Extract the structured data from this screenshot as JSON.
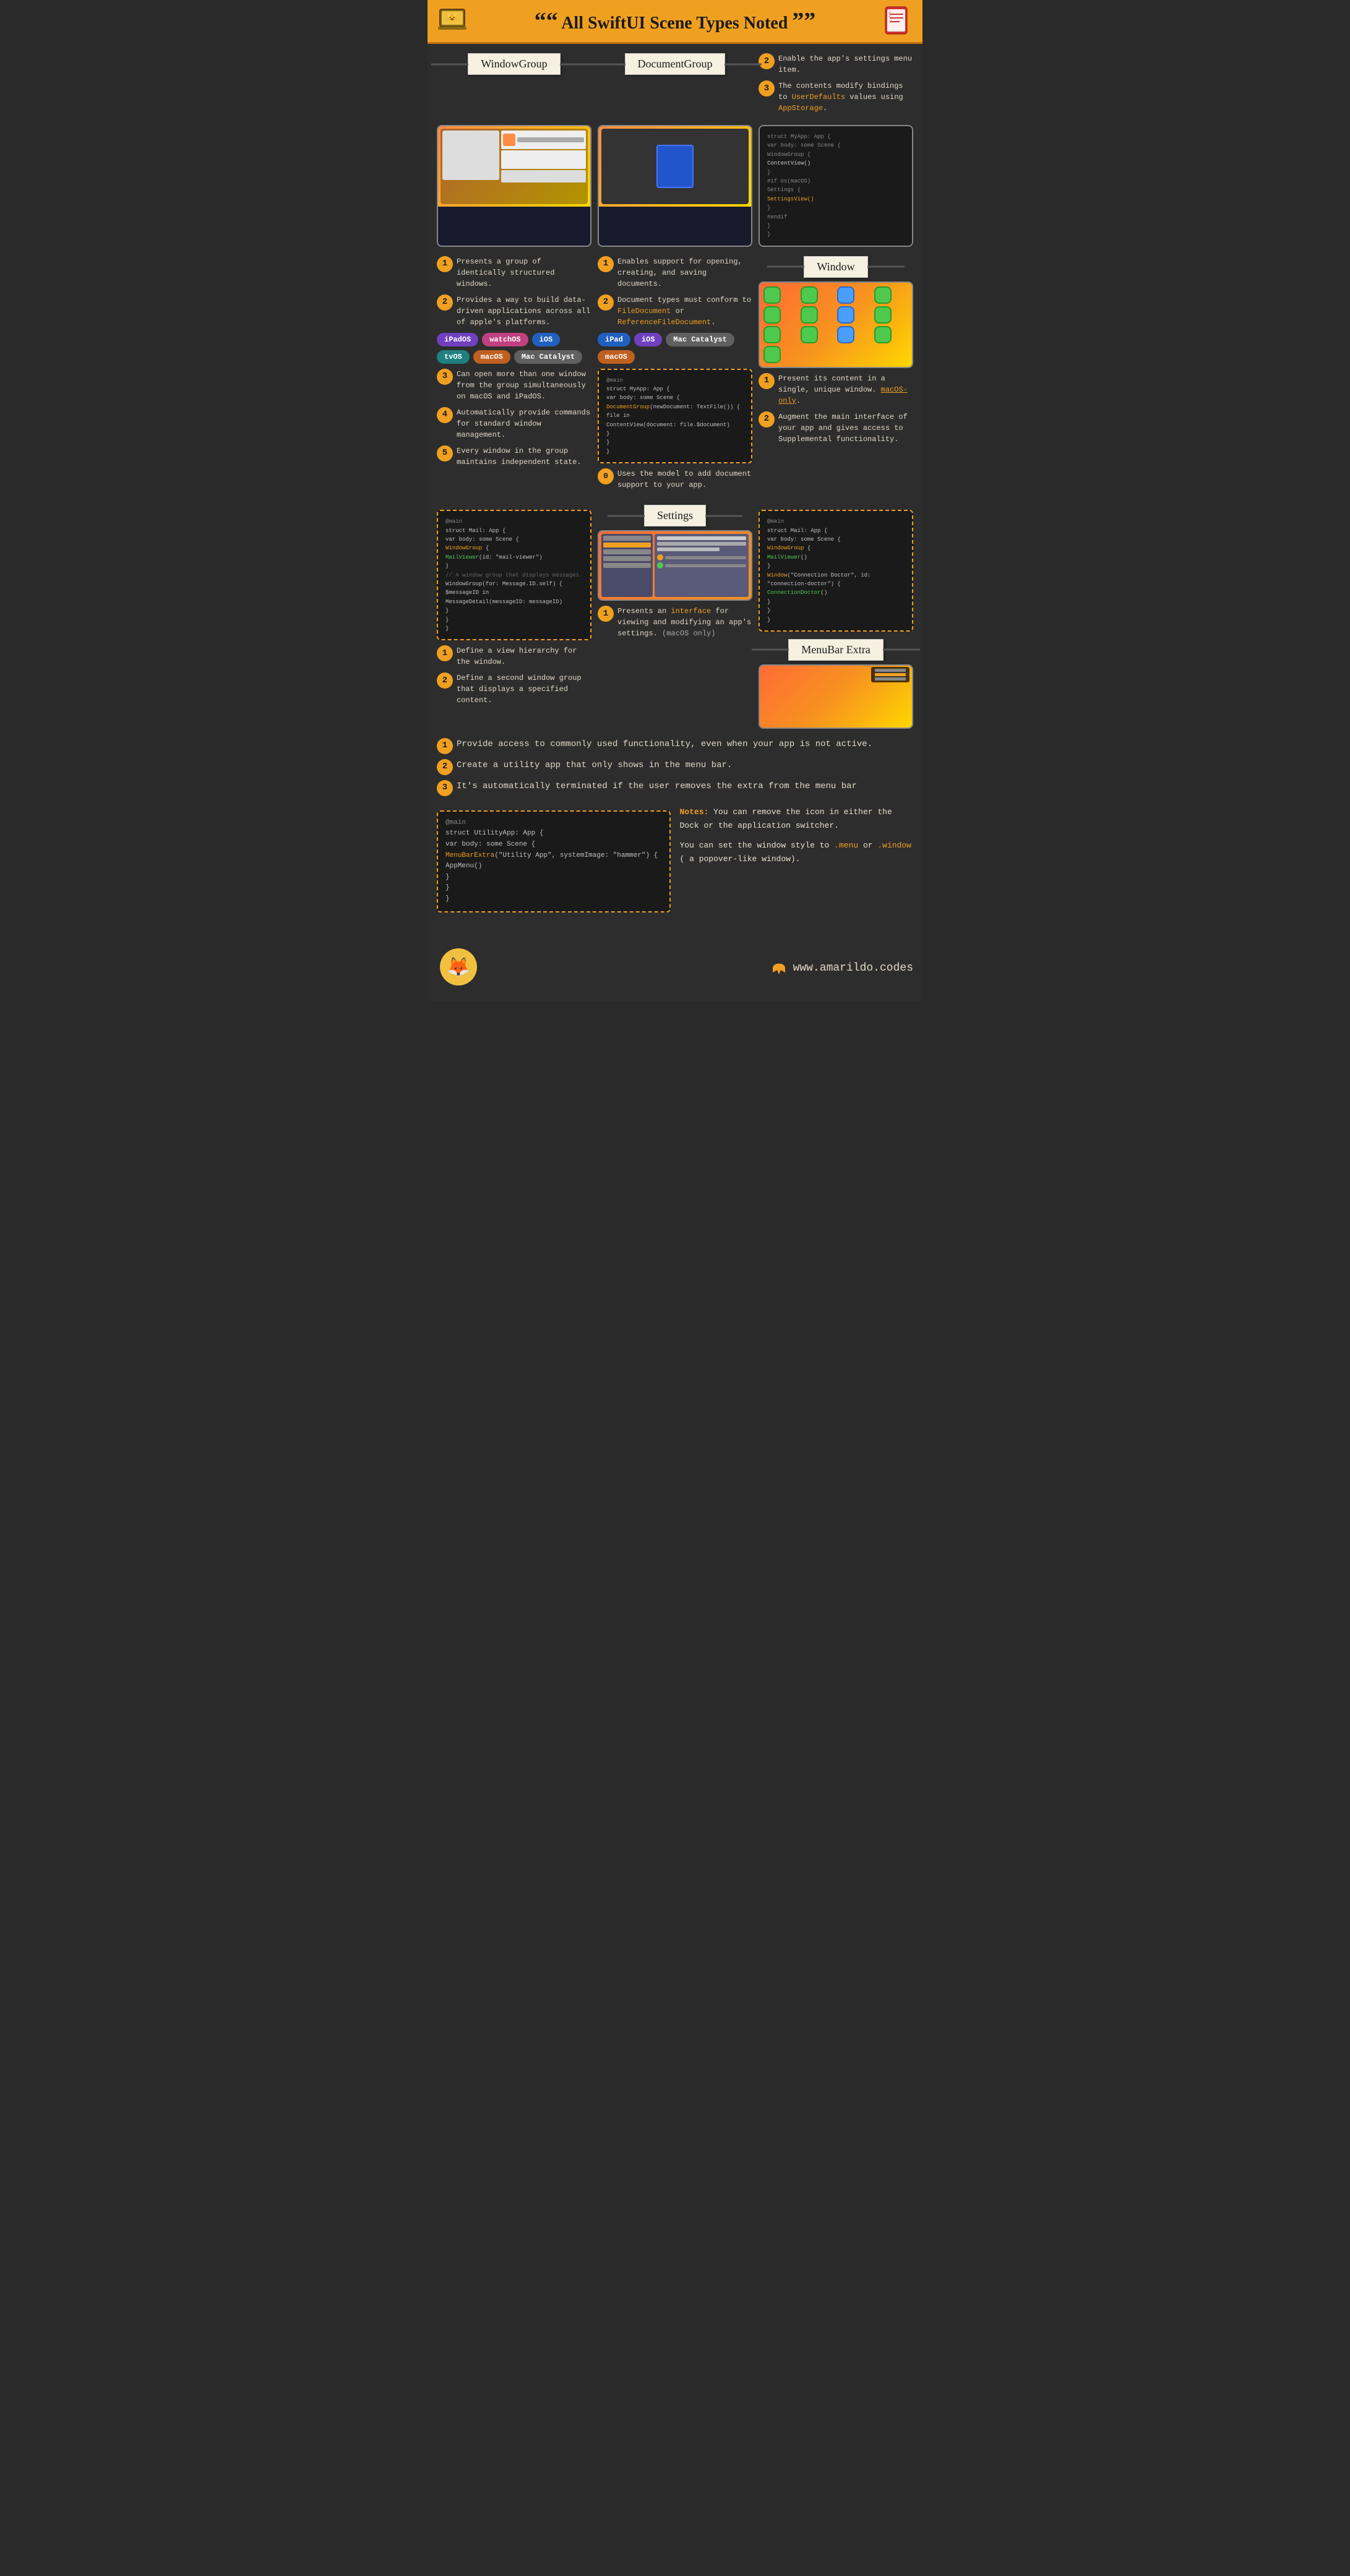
{
  "header": {
    "title": "All SwiftUI Scene Types Noted",
    "quote_open": "““",
    "quote_close": "””"
  },
  "sections": {
    "windowGroup": {
      "label": "WindowGroup",
      "point1": "Presents a group of identically structured windows.",
      "point2": "Provides a way to build data-driven applications across all of apple's platforms.",
      "point3": "Can open more than one window from the group simultaneously on macOS and iPadOS.",
      "point4": "Automatically provide commands for standard window management.",
      "point5": "Every window in the group maintains independent state.",
      "platforms": [
        "iPadOS",
        "watchOS",
        "iOS",
        "tvOS",
        "macOS",
        "Mac Catalyst"
      ],
      "point_define1": "Define a view hierarchy for the window.",
      "point_define2": "Define a second window group that displays a specified content."
    },
    "documentGroup": {
      "label": "DocumentGroup",
      "point1": "Enables support for opening, creating, and saving documents.",
      "point2": "Document types must conform to FileDocument or ReferenceFileDocument.",
      "platforms": [
        "iPad",
        "iOS",
        "Mac Catalyst",
        "macOS"
      ],
      "point_model": "Uses the model to add document support to your app."
    },
    "settings": {
      "label": "Settings",
      "point1": "Presents an interface for viewing and modifying an app's settings. (macOS only)"
    },
    "settingsRight": {
      "point2": "Enable the app's settings menu item.",
      "point3": "The contents modify bindings to UserDefaults values using AppStorage."
    },
    "window": {
      "label": "Window",
      "point1": "Present its content in a single, unique window. macOS-only.",
      "point2": "Augment the main interface of your app and gives access to Supplemental functionality."
    },
    "menuBarExtra": {
      "label": "MenuBar Extra",
      "point1": "Provide access to commonly used functionality, even when your app is not active.",
      "point2": "Create a utility app that only shows in the menu bar.",
      "point3": "It's automatically terminated if the user removes the extra from the menu bar"
    },
    "notes": {
      "label": "Notes:",
      "note1": "You can remove the icon in either the Dock or the application switcher.",
      "note2": "You can set the window style to .menu or .window ( a popover-like window).",
      "menu_style": ".menu",
      "window_style": ".window"
    }
  },
  "code": {
    "windowGroupCode": "@main\nstruct Mail: App {\n  var body: some Scene {\n    WindowGroup {\n      MailViewer(id: \"mail-viewer\")\n    }\n    // A window group that displays messages.\n    WindowGroup(for: Message.ID.self) { $messageID in\n      MessageDetail(messageID: messageID)\n    }\n  }\n}",
    "documentGroupCode": "@main\nstruct MyApp: App {\n  var body: some Scene {\n    DocumentGroup(newDocument: TextFile()) { file in\n      ContentView(document: file.$document)\n    }\n  }\n}",
    "settingsCode": "struct MyApp: App {\n  var body: some Scene {\n    WindowGroup {\n      ContentView()\n    }\n    #if os(macOS)\n    Settings {\n      SettingsView()\n    }\n    #endif\n  }\n}",
    "windowCode": "@main\nstruct Mail: App {\n  var body: some Scene {\n    WindowGroup {\n      MailViewer()\n    }\n    Window(\"Connection Doctor\", id: \"connection-doctor\") {\n      ConnectionDoctor()\n    }\n  }\n}",
    "menuBarCode": "@main\nstruct UtilityApp: App {\n  var body: some Scene {\n    MenuBarExtra(\"Utility App\", systemImage: \"hammer\") {\n      AppMenu()\n    }\n  }\n}"
  },
  "footer": {
    "website": "www.amarildo.codes"
  }
}
